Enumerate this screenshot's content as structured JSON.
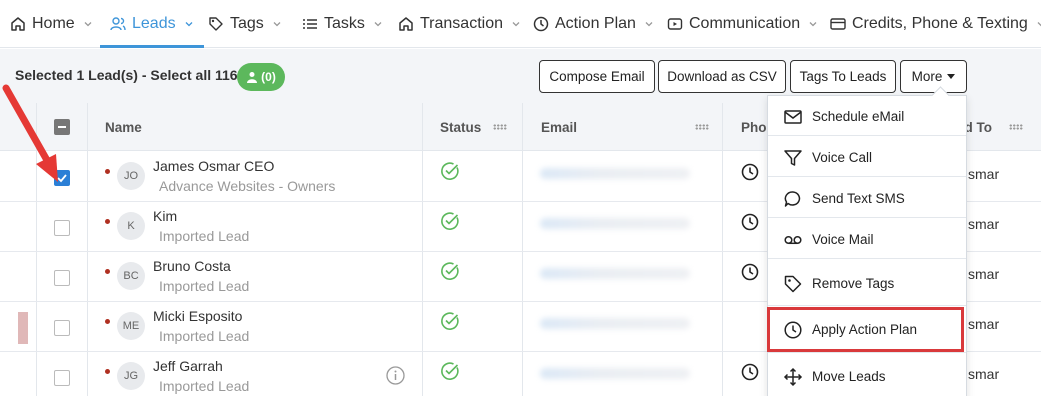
{
  "nav": {
    "items": [
      {
        "label": "Home",
        "icon": "home-icon"
      },
      {
        "label": "Leads",
        "icon": "users-icon",
        "active": true
      },
      {
        "label": "Tags",
        "icon": "tag-icon"
      },
      {
        "label": "Tasks",
        "icon": "list-icon"
      },
      {
        "label": "Transaction",
        "icon": "house-icon"
      },
      {
        "label": "Action Plan",
        "icon": "clock-icon"
      },
      {
        "label": "Communication",
        "icon": "video-icon"
      },
      {
        "label": "Credits, Phone & Texting",
        "icon": "card-icon"
      }
    ]
  },
  "toolbar": {
    "selected_text": "Selected 1 Lead(s) - ",
    "select_all_text": "Select all 1166",
    "badge_count": "(0)",
    "compose_email": "Compose Email",
    "download_csv": "Download as CSV",
    "tags_to_leads": "Tags To Leads",
    "more": "More"
  },
  "table": {
    "columns": [
      "Name",
      "Status",
      "Email",
      "Phon",
      "ed To"
    ],
    "rows": [
      {
        "initials": "JO",
        "name": "James Osmar CEO",
        "sub": "Advance Websites - Owners",
        "assigned": "smar",
        "checked": true
      },
      {
        "initials": "K",
        "name": "Kim",
        "sub": "Imported Lead",
        "assigned": "smar",
        "checked": false
      },
      {
        "initials": "BC",
        "name": "Bruno Costa",
        "sub": "Imported Lead",
        "assigned": "smar",
        "checked": false
      },
      {
        "initials": "ME",
        "name": "Micki Esposito",
        "sub": "Imported Lead",
        "assigned": "smar",
        "checked": false
      },
      {
        "initials": "JG",
        "name": "Jeff Garrah",
        "sub": "Imported Lead",
        "assigned": "smar",
        "checked": false
      }
    ]
  },
  "dropdown": {
    "items": [
      {
        "label": "Schedule eMail",
        "icon": "envelope-icon"
      },
      {
        "label": "Voice Call",
        "icon": "filter-icon"
      },
      {
        "label": "Send Text SMS",
        "icon": "chat-bubble-icon"
      },
      {
        "label": "Voice Mail",
        "icon": "voicemail-icon"
      },
      {
        "label": "Remove Tags",
        "icon": "tag-icon"
      },
      {
        "label": "Apply Action Plan",
        "icon": "clock-icon",
        "highlighted": true
      },
      {
        "label": "Move Leads",
        "icon": "move-arrows-icon"
      }
    ]
  },
  "colors": {
    "accent": "#3e95d9",
    "badge_green": "#5cb85c",
    "highlight_red": "#d9393b",
    "checkbox_blue": "#2b7fd6"
  }
}
